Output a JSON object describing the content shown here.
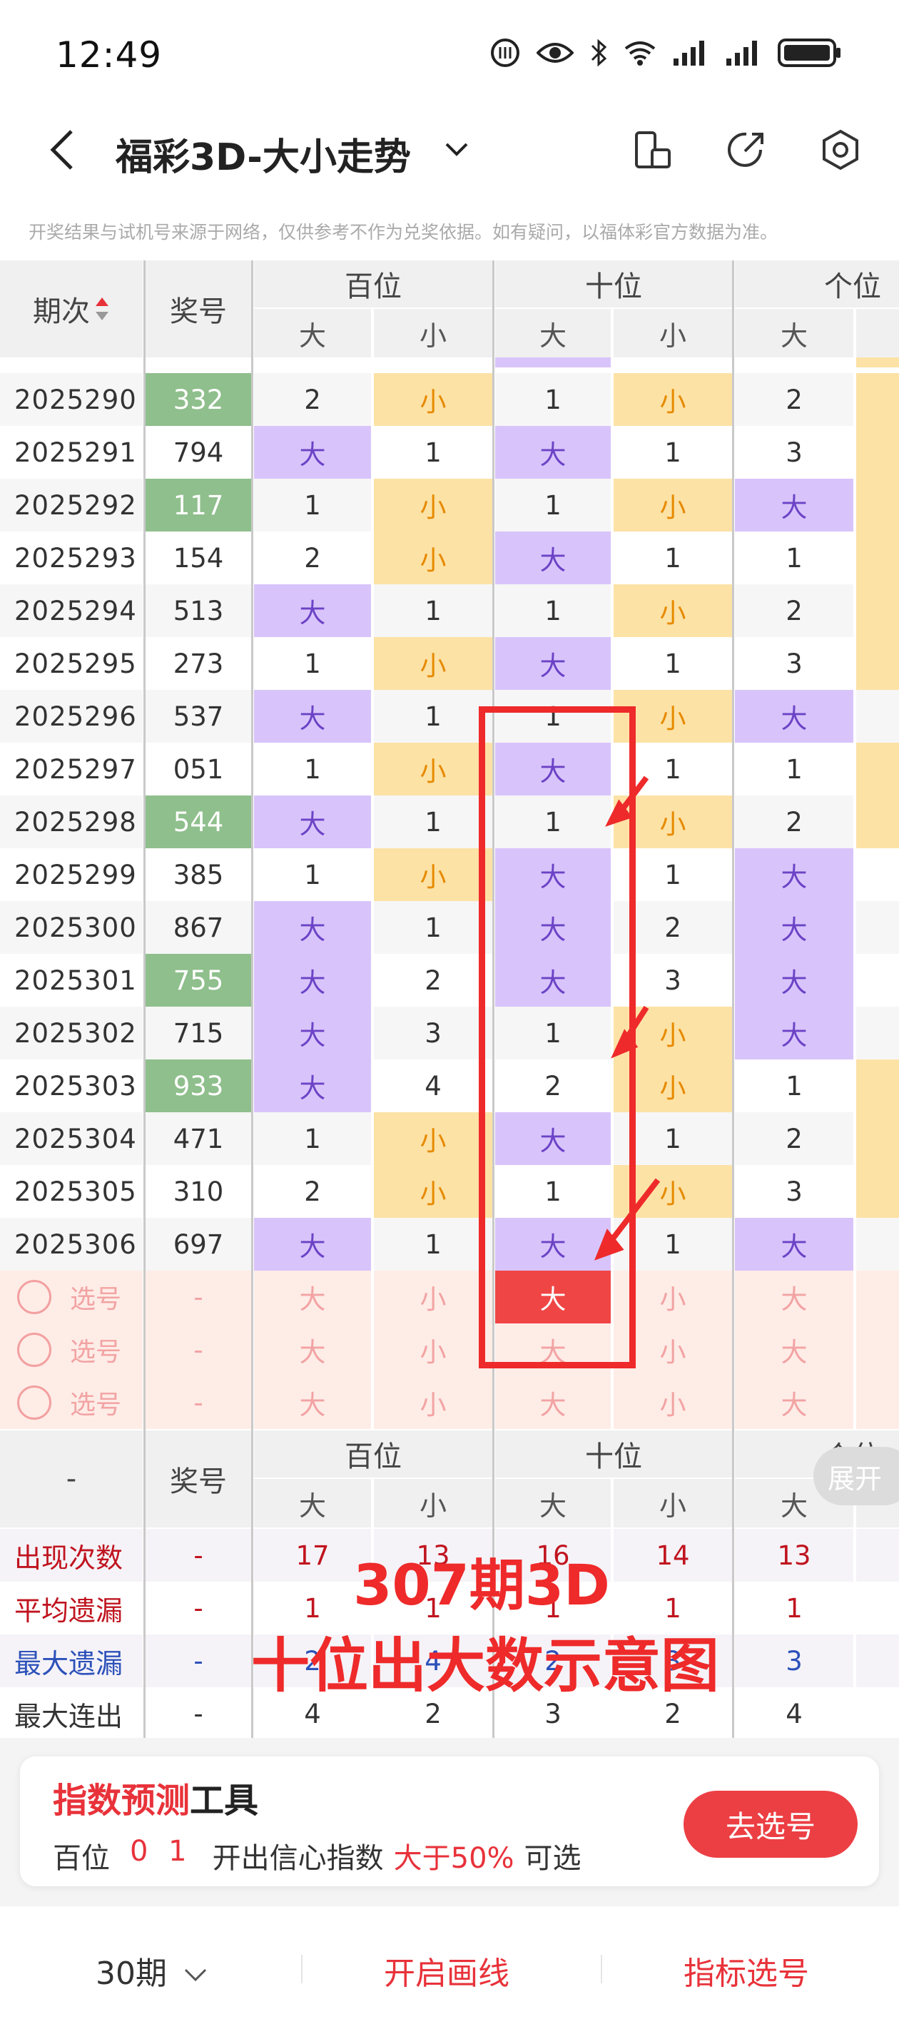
{
  "status_bar": {
    "time": "12:49"
  },
  "header": {
    "title": "福彩3D-大小走势"
  },
  "notice": "开奖结果与试机号来源于网络，仅供参考不作为兑奖依据。如有疑问，以福体彩官方数据为准。",
  "table": {
    "col_period": "期次",
    "col_number": "奖号",
    "groups": [
      "百位",
      "十位",
      "个位"
    ],
    "sub": [
      "大",
      "小",
      "大",
      "小",
      "大"
    ],
    "rows": [
      {
        "period": "2025290",
        "num": "332",
        "hl": true,
        "cells": [
          "2",
          "小",
          "1",
          "小",
          "2"
        ],
        "kinds": [
          "m",
          "s",
          "m",
          "s",
          "m"
        ],
        "edge": "s"
      },
      {
        "period": "2025291",
        "num": "794",
        "hl": false,
        "cells": [
          "大",
          "1",
          "大",
          "1",
          "3"
        ],
        "kinds": [
          "b",
          "m",
          "b",
          "m",
          "m"
        ],
        "edge": "s"
      },
      {
        "period": "2025292",
        "num": "117",
        "hl": true,
        "cells": [
          "1",
          "小",
          "1",
          "小",
          "大"
        ],
        "kinds": [
          "m",
          "s",
          "m",
          "s",
          "b"
        ],
        "edge": "s"
      },
      {
        "period": "2025293",
        "num": "154",
        "hl": false,
        "cells": [
          "2",
          "小",
          "大",
          "1",
          "1"
        ],
        "kinds": [
          "m",
          "s",
          "b",
          "m",
          "m"
        ],
        "edge": "s"
      },
      {
        "period": "2025294",
        "num": "513",
        "hl": false,
        "cells": [
          "大",
          "1",
          "1",
          "小",
          "2"
        ],
        "kinds": [
          "b",
          "m",
          "m",
          "s",
          "m"
        ],
        "edge": "s"
      },
      {
        "period": "2025295",
        "num": "273",
        "hl": false,
        "cells": [
          "1",
          "小",
          "大",
          "1",
          "3"
        ],
        "kinds": [
          "m",
          "s",
          "b",
          "m",
          "m"
        ],
        "edge": "s"
      },
      {
        "period": "2025296",
        "num": "537",
        "hl": false,
        "cells": [
          "大",
          "1",
          "1",
          "小",
          "大"
        ],
        "kinds": [
          "b",
          "m",
          "m",
          "s",
          "b"
        ],
        "edge": "n"
      },
      {
        "period": "2025297",
        "num": "051",
        "hl": false,
        "cells": [
          "1",
          "小",
          "大",
          "1",
          "1"
        ],
        "kinds": [
          "m",
          "s",
          "b",
          "m",
          "m"
        ],
        "edge": "s"
      },
      {
        "period": "2025298",
        "num": "544",
        "hl": true,
        "cells": [
          "大",
          "1",
          "1",
          "小",
          "2"
        ],
        "kinds": [
          "b",
          "m",
          "m",
          "s",
          "m"
        ],
        "edge": "s"
      },
      {
        "period": "2025299",
        "num": "385",
        "hl": false,
        "cells": [
          "1",
          "小",
          "大",
          "1",
          "大"
        ],
        "kinds": [
          "m",
          "s",
          "b",
          "m",
          "b"
        ],
        "edge": "n"
      },
      {
        "period": "2025300",
        "num": "867",
        "hl": false,
        "cells": [
          "大",
          "1",
          "大",
          "2",
          "大"
        ],
        "kinds": [
          "b",
          "m",
          "b",
          "m",
          "b"
        ],
        "edge": "n"
      },
      {
        "period": "2025301",
        "num": "755",
        "hl": true,
        "cells": [
          "大",
          "2",
          "大",
          "3",
          "大"
        ],
        "kinds": [
          "b",
          "m",
          "b",
          "m",
          "b"
        ],
        "edge": "n"
      },
      {
        "period": "2025302",
        "num": "715",
        "hl": false,
        "cells": [
          "大",
          "3",
          "1",
          "小",
          "大"
        ],
        "kinds": [
          "b",
          "m",
          "m",
          "s",
          "b"
        ],
        "edge": "n"
      },
      {
        "period": "2025303",
        "num": "933",
        "hl": true,
        "cells": [
          "大",
          "4",
          "2",
          "小",
          "1"
        ],
        "kinds": [
          "b",
          "m",
          "m",
          "s",
          "m"
        ],
        "edge": "s"
      },
      {
        "period": "2025304",
        "num": "471",
        "hl": false,
        "cells": [
          "1",
          "小",
          "大",
          "1",
          "2"
        ],
        "kinds": [
          "m",
          "s",
          "b",
          "m",
          "m"
        ],
        "edge": "s"
      },
      {
        "period": "2025305",
        "num": "310",
        "hl": false,
        "cells": [
          "2",
          "小",
          "1",
          "小",
          "3"
        ],
        "kinds": [
          "m",
          "s",
          "m",
          "s",
          "m"
        ],
        "edge": "s"
      },
      {
        "period": "2025306",
        "num": "697",
        "hl": false,
        "cells": [
          "大",
          "1",
          "大",
          "1",
          "大"
        ],
        "kinds": [
          "b",
          "m",
          "b",
          "m",
          "b"
        ],
        "edge": "n"
      }
    ],
    "select_rows": [
      {
        "label": "选号",
        "num": "-",
        "cells": [
          "大",
          "小",
          "大",
          "小",
          "大"
        ],
        "selected": 2
      },
      {
        "label": "选号",
        "num": "-",
        "cells": [
          "大",
          "小",
          "大",
          "小",
          "大"
        ],
        "selected": -1
      },
      {
        "label": "选号",
        "num": "-",
        "cells": [
          "大",
          "小",
          "大",
          "小",
          "大"
        ],
        "selected": -1
      }
    ]
  },
  "stats": {
    "dash": "-",
    "col_number": "奖号",
    "expand_label": "展开",
    "rows": [
      {
        "label": "出现次数",
        "num": "-",
        "cells": [
          "17",
          "13",
          "16",
          "14",
          "13"
        ],
        "color": "red"
      },
      {
        "label": "平均遗漏",
        "num": "-",
        "cells": [
          "1",
          "1",
          "1",
          "1",
          "1"
        ],
        "color": "red"
      },
      {
        "label": "最大遗漏",
        "num": "-",
        "cells": [
          "2",
          "4",
          "2",
          "3",
          "3"
        ],
        "color": "blue"
      },
      {
        "label": "最大连出",
        "num": "-",
        "cells": [
          "4",
          "2",
          "3",
          "2",
          "4"
        ],
        "color": "dark"
      }
    ]
  },
  "overlay": {
    "line1": "307期3D",
    "line2": "十位出大数示意图"
  },
  "predict_card": {
    "title_red": "指数预测",
    "title_black": "工具",
    "pos": "百位",
    "numbers": "0 1",
    "text": "开出信心指数",
    "pct": "大于50%",
    "suffix": "可选",
    "button": "去选号"
  },
  "bottom_bar": {
    "period": "30期",
    "draw": "开启画线",
    "metric": "指标选号"
  },
  "colors": {
    "big": "#d8c4fb",
    "small": "#fde2a6",
    "highlight": "#8fbf8c",
    "accent": "#e8323a"
  }
}
